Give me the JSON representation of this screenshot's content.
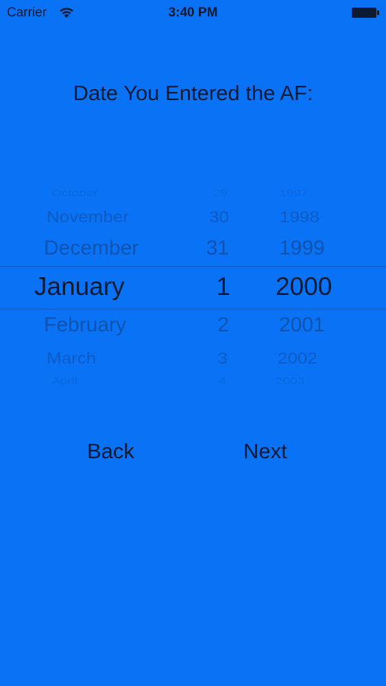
{
  "status_bar": {
    "carrier": "Carrier",
    "time": "3:40 PM"
  },
  "heading": "Date You Entered the AF:",
  "picker": {
    "months": [
      "October",
      "November",
      "December",
      "January",
      "February",
      "March",
      "April"
    ],
    "days": [
      "29",
      "30",
      "31",
      "1",
      "2",
      "3",
      "4"
    ],
    "years": [
      "1997",
      "1998",
      "1999",
      "2000",
      "2001",
      "2002",
      "2003"
    ],
    "selected": {
      "month": "January",
      "day": "1",
      "year": "2000"
    }
  },
  "buttons": {
    "back": "Back",
    "next": "Next"
  },
  "colors": {
    "background": "#0a72f5",
    "text": "#0c1a33"
  }
}
